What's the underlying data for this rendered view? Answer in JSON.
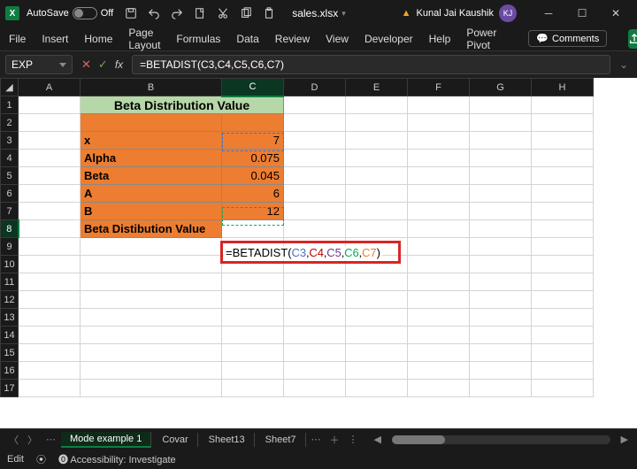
{
  "titlebar": {
    "autosave_label": "AutoSave",
    "autosave_state": "Off",
    "filename": "sales.xlsx",
    "user_name": "Kunal Jai Kaushik",
    "user_initials": "KJ"
  },
  "ribbon": {
    "tabs": [
      "File",
      "Insert",
      "Home",
      "Page Layout",
      "Formulas",
      "Data",
      "Review",
      "View",
      "Developer",
      "Help",
      "Power Pivot"
    ],
    "comments": "Comments"
  },
  "formula_bar": {
    "namebox": "EXP",
    "formula": "=BETADIST(C3,C4,C5,C6,C7)"
  },
  "columns": [
    "A",
    "B",
    "C",
    "D",
    "E",
    "F",
    "G",
    "H"
  ],
  "rows": [
    "1",
    "2",
    "3",
    "4",
    "5",
    "6",
    "7",
    "8",
    "9",
    "10",
    "11",
    "12",
    "13",
    "14",
    "15",
    "16",
    "17"
  ],
  "cells": {
    "header": "Beta Distribution Value",
    "r3_label": "x",
    "r3_val": "7",
    "r4_label": "Alpha",
    "r4_val": "0.075",
    "r5_label": "Beta",
    "r5_val": "0.045",
    "r6_label": "A",
    "r6_val": "6",
    "r7_label": "B",
    "r7_val": "12",
    "r8_label": "Beta Distibution Value",
    "r8_formula_prefix": "=BETADIST(",
    "r8_c3": "C3",
    "r8_c4": "C4",
    "r8_c5": "C5",
    "r8_c6": "C6",
    "r8_c7": "C7",
    "r8_formula_suffix": ")"
  },
  "sheets": {
    "tabs": [
      "Mode example 1",
      "Covar",
      "Sheet13",
      "Sheet7"
    ],
    "active": 0
  },
  "statusbar": {
    "mode": "Edit",
    "accessibility": "Accessibility: Investigate"
  }
}
